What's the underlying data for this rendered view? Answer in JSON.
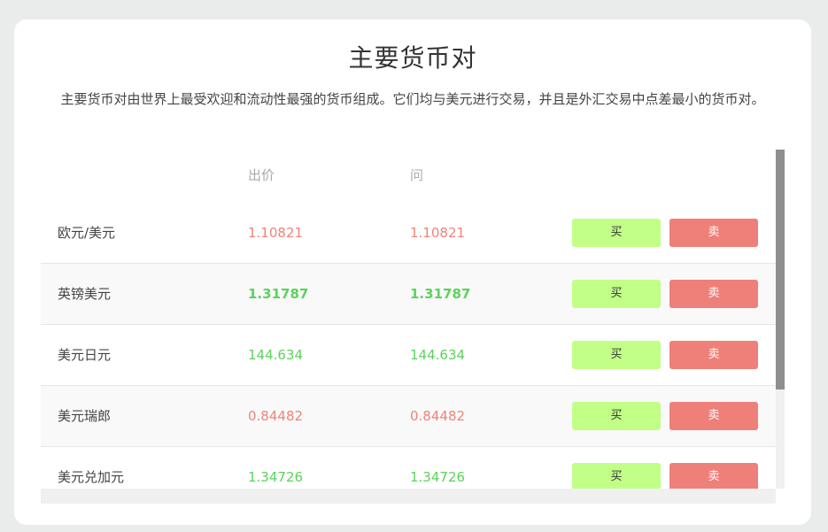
{
  "header": {
    "title": "主要货币对",
    "description": "主要货币对由世界上最受欢迎和流动性最强的货币组成。它们均与美元进行交易，并且是外汇交易中点差最小的货币对。"
  },
  "table": {
    "columns": {
      "bid": "出价",
      "ask": "问"
    },
    "buy_label": "买",
    "sell_label": "卖",
    "rows": [
      {
        "pair": "欧元/美元",
        "bid": "1.10821",
        "ask": "1.10821",
        "color": "red",
        "bold": false
      },
      {
        "pair": "英镑美元",
        "bid": "1.31787",
        "ask": "1.31787",
        "color": "green",
        "bold": true
      },
      {
        "pair": "美元日元",
        "bid": "144.634",
        "ask": "144.634",
        "color": "green",
        "bold": false
      },
      {
        "pair": "美元瑞郎",
        "bid": "0.84482",
        "ask": "0.84482",
        "color": "red",
        "bold": false
      },
      {
        "pair": "美元兑加元",
        "bid": "1.34726",
        "ask": "1.34726",
        "color": "green",
        "bold": false
      }
    ]
  },
  "colors": {
    "price_up": "#59d45b",
    "price_down": "#ef8478",
    "buy_button": "#c1ff87",
    "sell_button": "#ef7f79"
  }
}
